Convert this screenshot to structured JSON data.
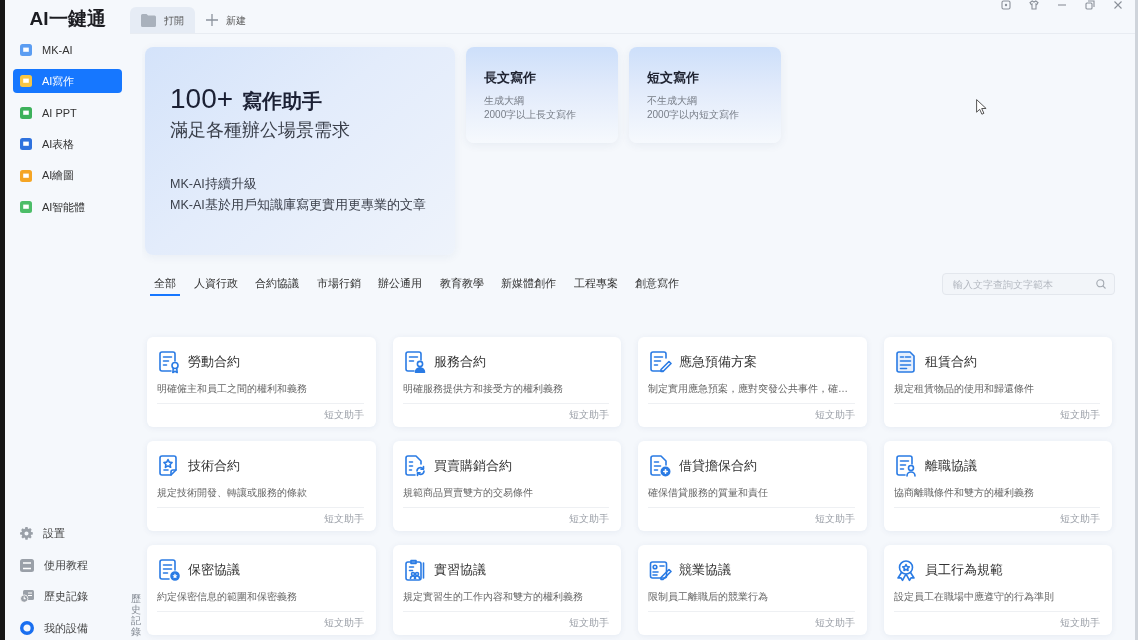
{
  "top_bar": {
    "logo": "AI一鍵通",
    "tabs": [
      {
        "kind": "folder",
        "label": "打開",
        "selected": true
      },
      {
        "kind": "add",
        "label": "新建",
        "selected": false
      }
    ]
  },
  "sidebar": {
    "items": [
      {
        "label": "MK-AI",
        "color": "#5b9df2",
        "selected": false
      },
      {
        "label": "AI寫作",
        "color": "#f6c544",
        "selected": true
      },
      {
        "label": "AI PPT",
        "color": "#3db15b",
        "selected": false
      },
      {
        "label": "AI表格",
        "color": "#2f72de",
        "selected": false
      },
      {
        "label": "AI繪圖",
        "color": "#f5a524",
        "selected": false
      },
      {
        "label": "AI智能體",
        "color": "#4cbd68",
        "selected": false
      }
    ],
    "bottom_items": [
      {
        "kind": "settings",
        "label": "設置"
      },
      {
        "kind": "tutorial",
        "label": "使用教程"
      },
      {
        "kind": "history",
        "label": "歷史記錄"
      },
      {
        "kind": "device",
        "label": "我的設備"
      }
    ]
  },
  "history_tab": {
    "label": "歷史記錄"
  },
  "hero": {
    "count": "100+",
    "title": "寫作助手",
    "subtitle": "滿足各種辦公場景需求",
    "lines": [
      "MK-AI持續升級",
      "MK-AI基於用戶知識庫寫更實用更專業的文章"
    ]
  },
  "modes": [
    {
      "title": "長文寫作",
      "lines": [
        "生成大綱",
        "2000字以上長文寫作"
      ]
    },
    {
      "title": "短文寫作",
      "lines": [
        "不生成大綱",
        "2000字以內短文寫作"
      ]
    }
  ],
  "categories": [
    {
      "label": "全部",
      "selected": true
    },
    {
      "label": "人資行政",
      "selected": false
    },
    {
      "label": "合約協議",
      "selected": false
    },
    {
      "label": "市場行銷",
      "selected": false
    },
    {
      "label": "辦公通用",
      "selected": false
    },
    {
      "label": "教育教學",
      "selected": false
    },
    {
      "label": "新媒體創作",
      "selected": false
    },
    {
      "label": "工程專案",
      "selected": false
    },
    {
      "label": "創意寫作",
      "selected": false
    }
  ],
  "search": {
    "placeholder": "輸入文字查詢文字範本"
  },
  "templates": [
    {
      "title": "勞動合約",
      "description": "明確僱主和員工之間的權利和義務",
      "tag": "短文助手"
    },
    {
      "title": "服務合約",
      "description": "明確服務提供方和接受方的權利義務",
      "tag": "短文助手"
    },
    {
      "title": "應急預備方案",
      "description": "制定實用應急預案，應對突發公共事件，確…",
      "tag": "短文助手"
    },
    {
      "title": "租賃合約",
      "description": "規定租賃物品的使用和歸還條件",
      "tag": "短文助手"
    },
    {
      "title": "技術合約",
      "description": "規定技術開發、轉讓或服務的條款",
      "tag": "短文助手"
    },
    {
      "title": "買賣購銷合約",
      "description": "規範商品買賣雙方的交易條件",
      "tag": "短文助手"
    },
    {
      "title": "借貸擔保合約",
      "description": "確保借貸服務的質量和責任",
      "tag": "短文助手"
    },
    {
      "title": "離職協議",
      "description": "協商離職條件和雙方的權利義務",
      "tag": "短文助手"
    },
    {
      "title": "保密協議",
      "description": "約定保密信息的範圍和保密義務",
      "tag": "短文助手"
    },
    {
      "title": "實習協議",
      "description": "規定實習生的工作內容和雙方的權利義務",
      "tag": "短文助手"
    },
    {
      "title": "競業協議",
      "description": "限制員工離職后的競業行為",
      "tag": "短文助手"
    },
    {
      "title": "員工行為規範",
      "description": "設定員工在職場中應遵守的行為準則",
      "tag": "短文助手"
    }
  ]
}
